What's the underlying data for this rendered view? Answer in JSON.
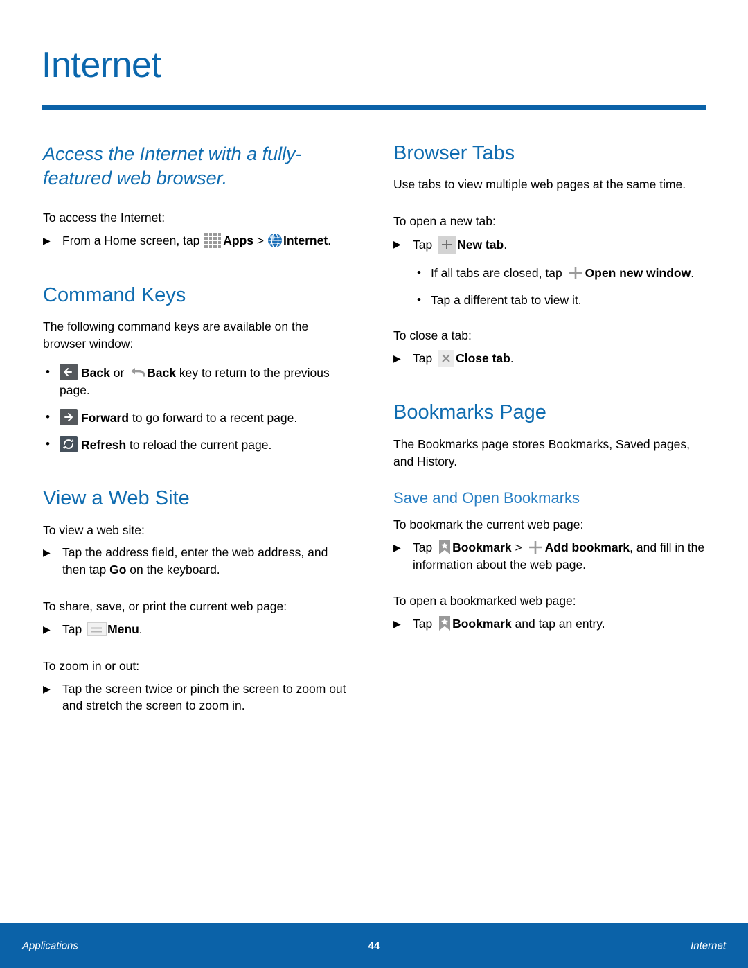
{
  "header": {
    "chapter_title": "Internet"
  },
  "colors": {
    "brand_blue": "#0b62a8",
    "heading_blue": "#0f6cb0",
    "subheading_blue": "#2a80c4",
    "icon_dark": "#55595d",
    "icon_refresh": "#46515c"
  },
  "left_column": {
    "lead": "Access the Internet with a fully-featured web browser.",
    "access": {
      "intro": "To access the Internet:",
      "step_pre": "From a Home screen, tap ",
      "step_apps": "Apps",
      "step_gt": " > ",
      "step_internet": "Internet",
      "step_end": "."
    },
    "command_keys": {
      "heading": "Command Keys",
      "body": "The following command keys are available on the browser window:",
      "bullets": [
        {
          "back_label": "Back",
          "or_text": " or ",
          "backkey_label": "Back",
          "rest": " key to return to the previous page."
        },
        {
          "label": "Forward",
          "rest": " to go forward to a recent page."
        },
        {
          "label": "Refresh",
          "rest": " to reload the current page."
        }
      ]
    },
    "view_web_site": {
      "heading": "View a Web Site",
      "intro_view": "To view a web site:",
      "step_view_pre": "Tap the address field, enter the web address, and then tap ",
      "step_view_go": "Go",
      "step_view_post": " on the keyboard.",
      "intro_share": "To share, save, or print the current web page:",
      "step_share_pre": "Tap ",
      "step_share_menu": "Menu",
      "step_share_post": ".",
      "intro_zoom": "To zoom in or out:",
      "step_zoom": "Tap the screen twice or pinch the screen to zoom out and stretch the screen to zoom in."
    }
  },
  "right_column": {
    "browser_tabs": {
      "heading": "Browser Tabs",
      "body": "Use tabs to view multiple web pages at the same time.",
      "intro_open": "To open a new tab:",
      "step_open_pre": "Tap ",
      "step_open_label": "New tab",
      "step_open_post": ".",
      "sub_bullets": [
        {
          "pre": "If all tabs are closed, tap ",
          "label": "Open new window",
          "post": "."
        },
        {
          "pre": "Tap a different tab to view it.",
          "label": "",
          "post": ""
        }
      ],
      "intro_close": "To close a tab:",
      "step_close_pre": "Tap ",
      "step_close_label": "Close tab",
      "step_close_post": "."
    },
    "bookmarks_page": {
      "heading": "Bookmarks Page",
      "body": "The Bookmarks page stores Bookmarks, Saved pages, and History.",
      "subheading": "Save and Open Bookmarks",
      "intro_bookmark": "To bookmark the current web page:",
      "step_bookmark_pre": "Tap ",
      "step_bookmark_label": "Bookmark",
      "step_bookmark_gt": " > ",
      "step_bookmark_add": "Add bookmark",
      "step_bookmark_post": ", and fill in the information about the web page.",
      "intro_open": "To open a bookmarked web page:",
      "step_open_pre": "Tap ",
      "step_open_label": "Bookmark",
      "step_open_post": " and tap an entry."
    }
  },
  "footer": {
    "left": "Applications",
    "page_number": "44",
    "right": "Internet"
  },
  "icons": {
    "apps": "apps-grid-icon",
    "internet": "globe-icon",
    "back": "back-arrow-icon",
    "backkey": "back-key-icon",
    "forward": "forward-arrow-icon",
    "refresh": "refresh-icon",
    "menu": "menu-icon",
    "newtab": "plus-square-icon",
    "closetab": "close-x-icon",
    "plus": "plus-icon",
    "bookmark": "bookmark-star-icon"
  },
  "markers": {
    "triangle": "▶",
    "bullet": "•"
  }
}
